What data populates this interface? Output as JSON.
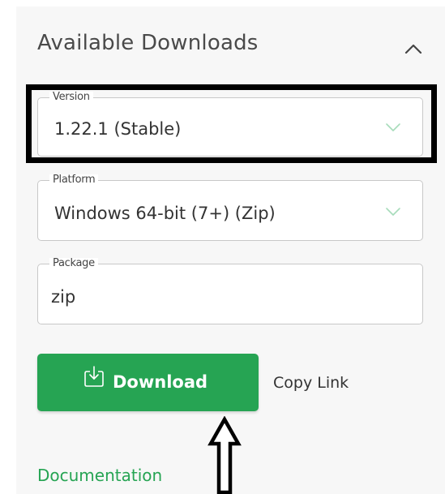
{
  "panel": {
    "title": "Available Downloads",
    "collapse_icon": "chevron-up-icon"
  },
  "fields": {
    "version": {
      "label": "Version",
      "value": "1.22.1 (Stable)",
      "dropdown_icon": "chevron-down-icon"
    },
    "platform": {
      "label": "Platform",
      "value": "Windows 64-bit (7+) (Zip)",
      "dropdown_icon": "chevron-down-icon"
    },
    "package": {
      "label": "Package",
      "value": "zip"
    }
  },
  "actions": {
    "download_label": "Download",
    "download_icon": "download-icon",
    "copy_link_label": "Copy Link"
  },
  "links": {
    "documentation": "Documentation"
  },
  "colors": {
    "accent": "#26a453",
    "panel_bg": "#f7f7f7",
    "field_border": "#c8c8c8",
    "annotation": "#000000"
  },
  "annotations": {
    "highlight_box": "highlight-box",
    "pointer_arrow": "up-arrow-annotation"
  }
}
